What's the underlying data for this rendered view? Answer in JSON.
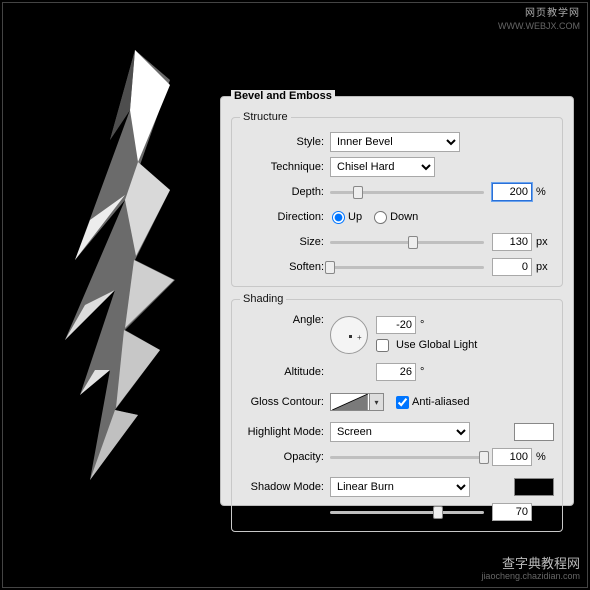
{
  "watermark_top": {
    "line1": "网页教学网",
    "line2": "WWW.WEBJX.COM"
  },
  "watermark_bottom": {
    "line1": "查字典教程网",
    "line2": "jiaocheng.chazidian.com"
  },
  "panel_title": "Bevel and Emboss",
  "structure": {
    "legend": "Structure",
    "style_label": "Style:",
    "style_value": "Inner Bevel",
    "technique_label": "Technique:",
    "technique_value": "Chisel Hard",
    "depth_label": "Depth:",
    "depth_value": "200",
    "depth_unit": "%",
    "direction_label": "Direction:",
    "direction_up": "Up",
    "direction_down": "Down",
    "size_label": "Size:",
    "size_value": "130",
    "size_unit": "px",
    "soften_label": "Soften:",
    "soften_value": "0",
    "soften_unit": "px"
  },
  "shading": {
    "legend": "Shading",
    "angle_label": "Angle:",
    "angle_value": "-20",
    "angle_unit": "°",
    "global_light": "Use Global Light",
    "altitude_label": "Altitude:",
    "altitude_value": "26",
    "altitude_unit": "°",
    "gloss_label": "Gloss Contour:",
    "antialiased": "Anti-aliased",
    "highlight_label": "Highlight Mode:",
    "highlight_value": "Screen",
    "highlight_color": "#ffffff",
    "opacity_label": "Opacity:",
    "highlight_opacity": "100",
    "opacity_unit": "%",
    "shadow_label": "Shadow Mode:",
    "shadow_value": "Linear Burn",
    "shadow_color": "#000000",
    "shadow_opacity": "70"
  }
}
